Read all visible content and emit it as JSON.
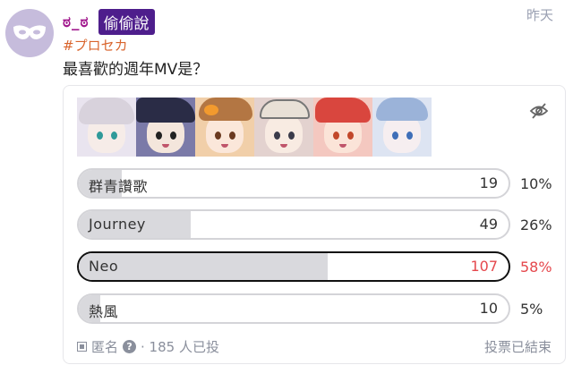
{
  "post": {
    "avatar_icon": "masquerade-mask-icon",
    "username": "ಠ_ಠ",
    "badge": "偷偷說",
    "time": "昨天",
    "tag": "#プロセカ",
    "title": "最喜歡的週年MV是？"
  },
  "poll": {
    "hide_results_icon": "eye-slash-icon",
    "thumbnails": [
      "thumb-1",
      "thumb-2",
      "thumb-3",
      "thumb-4",
      "thumb-5",
      "thumb-6"
    ],
    "options": [
      {
        "label": "群青讚歌",
        "votes": "19",
        "percent": "10%",
        "fraction": 0.1,
        "selected": false
      },
      {
        "label": "Journey",
        "votes": "49",
        "percent": "26%",
        "fraction": 0.26,
        "selected": false
      },
      {
        "label": "Neo",
        "votes": "107",
        "percent": "58%",
        "fraction": 0.58,
        "selected": true
      },
      {
        "label": "熱風",
        "votes": "10",
        "percent": "5%",
        "fraction": 0.05,
        "selected": false
      }
    ],
    "footer": {
      "anonymous_label": "匿名",
      "help_icon": "question-circle-icon",
      "voters_text": "· 185 人已投",
      "status": "投票已結束"
    }
  },
  "colors": {
    "username": "#a0168c",
    "badge_bg": "#4e1e8c",
    "tag": "#d9642c",
    "highlight": "#e5484d",
    "bar_fill": "#d9d9dd"
  }
}
